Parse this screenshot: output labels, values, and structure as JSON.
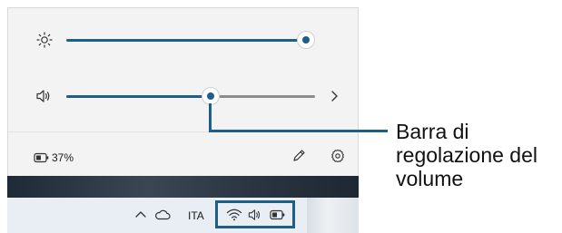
{
  "accent_color": "#1e5f8a",
  "quick_settings": {
    "brightness": {
      "icon": "brightness-icon",
      "level": 1.0
    },
    "volume": {
      "icon": "speaker-icon",
      "level": 0.58,
      "expand_icon": "chevron-right-icon"
    },
    "battery": {
      "icon": "battery-icon",
      "percent_label": "37%"
    },
    "footer_icons": [
      "edit-pencil-icon",
      "settings-gear-icon"
    ]
  },
  "taskbar": {
    "icons_left": [
      "chevron-up-icon",
      "onedrive-cloud-icon"
    ],
    "language": "ITA",
    "system_tray_icons": [
      "wifi-icon",
      "speaker-icon",
      "battery-icon"
    ]
  },
  "callout": {
    "line1": "Barra di",
    "line2": "regolazione del",
    "line3": "volume"
  }
}
